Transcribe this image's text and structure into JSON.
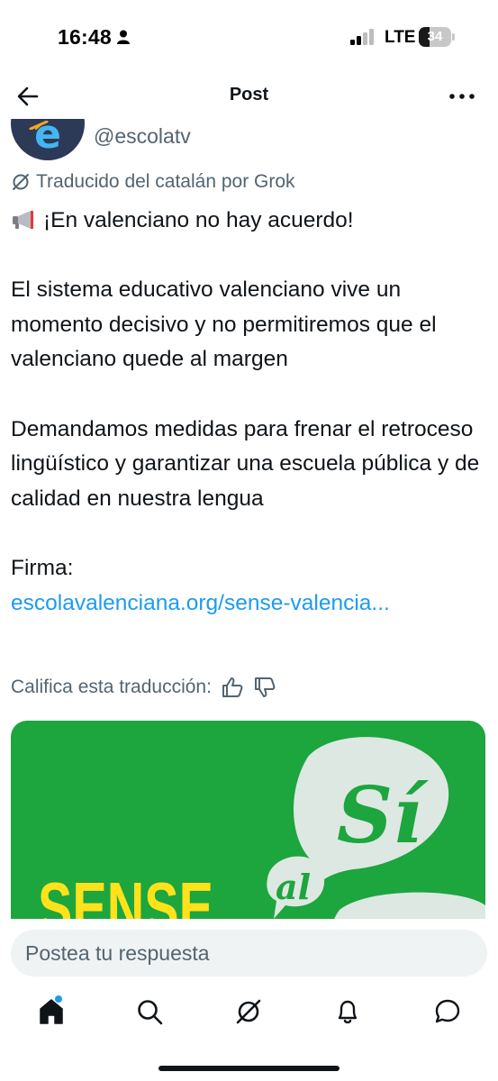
{
  "status_bar": {
    "time": "16:48",
    "network": "LTE",
    "battery": "34",
    "battery_level_percent": 34
  },
  "header": {
    "title": "Post",
    "back_icon": "arrow-left-icon",
    "more_icon": "more-horizontal-icon"
  },
  "author": {
    "handle": "@escolatv",
    "avatar_letter": "e"
  },
  "translation": {
    "note": "Traducido del catalán por Grok",
    "rate_label": "Califica esta traducción:"
  },
  "tweet": {
    "line_1": "¡En valenciano no hay acuerdo!",
    "paragraph_2": "El sistema educativo valenciano vive un momento decisivo y no permitiremos que el valenciano quede al margen",
    "paragraph_3": "Demandamos medidas para frenar el retroceso lingüístico y garantizar una escuela pública y de calidad en nuestra lengua",
    "sign_label": "Firma:",
    "link": "escolavalenciana.org/sense-valencia..."
  },
  "image": {
    "word_sense": "SENSE",
    "word_si": "Sí",
    "word_al": "al",
    "colors": {
      "background": "#1da53e",
      "yellow": "#ffe21a",
      "bubble": "#dde8e2"
    }
  },
  "reply": {
    "placeholder": "Postea tu respuesta"
  },
  "tabbar": {
    "items": [
      "home-icon",
      "search-icon",
      "grok-icon",
      "bell-icon",
      "messages-icon"
    ],
    "active": "home-icon"
  },
  "colors": {
    "accent": "#1d9bf0",
    "text": "#0f1419",
    "secondary": "#536471"
  }
}
